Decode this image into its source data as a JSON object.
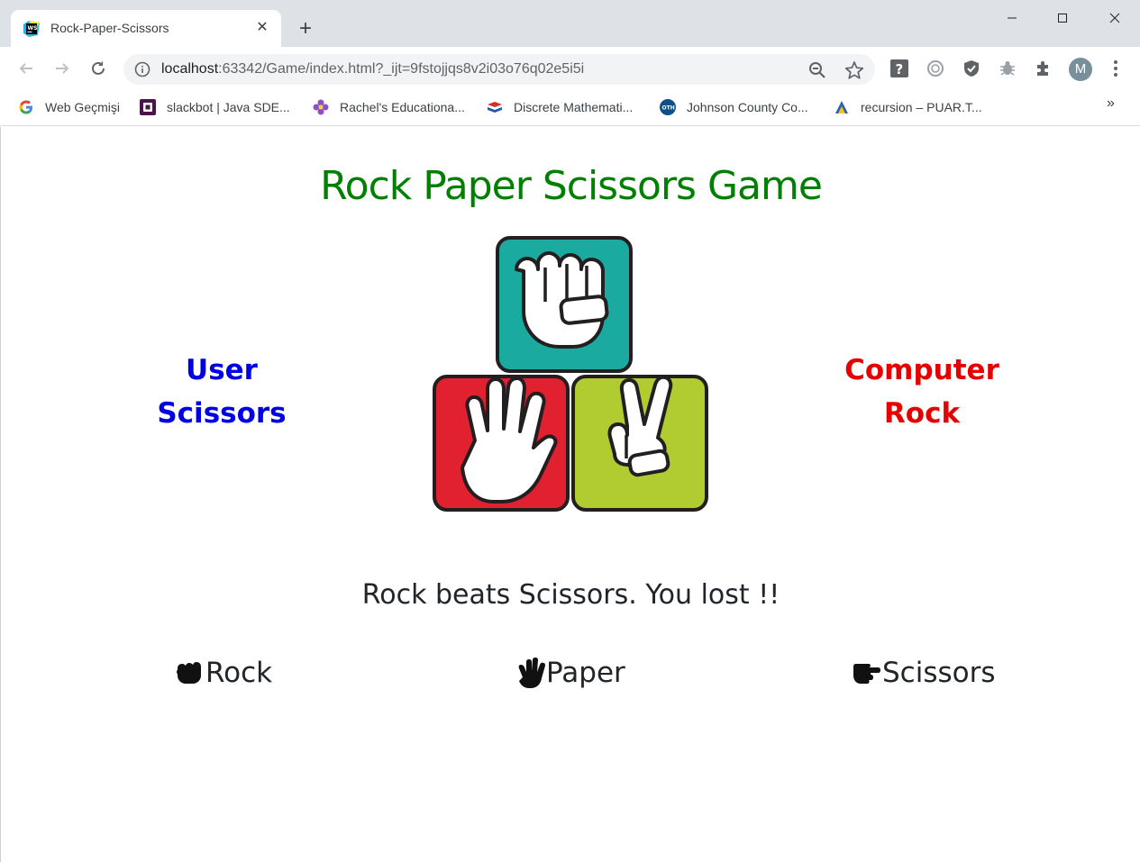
{
  "browser": {
    "tab_title": "Rock-Paper-Scissors",
    "url_host": "localhost",
    "url_rest": ":63342/Game/index.html?_ijt=9fstojjqs8v2i03o76q02e5i5i",
    "profile_initial": "M",
    "bookmarks": [
      {
        "label": "Web Geçmişi",
        "icon": "google-icon"
      },
      {
        "label": "slackbot | Java SDE...",
        "icon": "slack-icon"
      },
      {
        "label": "Rachel's Educationa...",
        "icon": "flower-icon"
      },
      {
        "label": "Discrete Mathemati...",
        "icon": "book-icon"
      },
      {
        "label": "Johnson County Co...",
        "icon": "jccc-icon"
      },
      {
        "label": "recursion – PUAR.T...",
        "icon": "puar-icon"
      }
    ],
    "bookmarks_more": "»"
  },
  "game": {
    "title": "Rock Paper Scissors Game",
    "user_label": "User",
    "user_choice": "Scissors",
    "computer_label": "Computer",
    "computer_choice": "Rock",
    "result_message": "Rock beats Scissors. You lost !!",
    "choices": [
      {
        "label": "Rock",
        "icon": "hand-rock-icon"
      },
      {
        "label": " Paper",
        "icon": "hand-paper-icon"
      },
      {
        "label": " Scissors",
        "icon": "hand-scissors-icon"
      }
    ]
  },
  "colors": {
    "title": "#008000",
    "user": "#0000e6",
    "computer": "#e60000",
    "rock_tile": "#1aaa9f",
    "paper_tile": "#e12030",
    "scissors_tile": "#b0cc30"
  }
}
